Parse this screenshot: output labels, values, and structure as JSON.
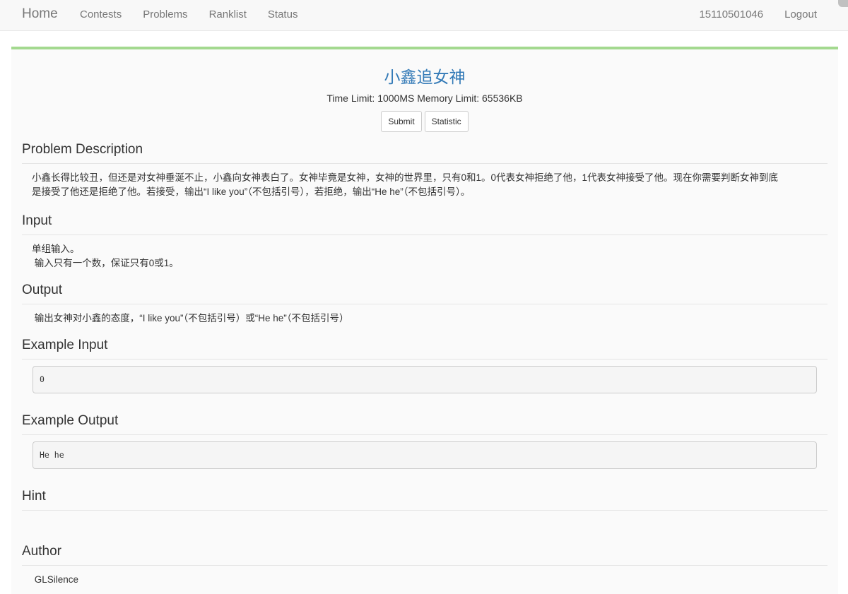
{
  "navbar": {
    "brand": "Home",
    "links": [
      "Contests",
      "Problems",
      "Ranklist",
      "Status"
    ],
    "user": "15110501046",
    "logout": "Logout"
  },
  "problem": {
    "title": "小鑫追女神",
    "limits": "Time Limit: 1000MS Memory Limit: 65536KB",
    "submit_label": "Submit",
    "statistic_label": "Statistic"
  },
  "sections": {
    "description_title": "Problem Description",
    "description_line1": "小鑫长得比较丑，但还是对女神垂涎不止，小鑫向女神表白了。女神毕竟是女神，女神的世界里，只有0和1。0代表女神拒绝了他，1代表女神接受了他。现在你需要判断女神到底",
    "description_line2": "是接受了他还是拒绝了他。若接受，输出“I like you”（不包括引号），若拒绝，输出“He he”（不包括引号）。",
    "input_title": "Input",
    "input_line1": "单组输入。",
    "input_line2": " 输入只有一个数，保证只有0或1。",
    "output_title": "Output",
    "output_text": " 输出女神对小鑫的态度，“I like you”（不包括引号）或“He he”（不包括引号）",
    "example_input_title": "Example Input",
    "example_input": "0",
    "example_output_title": "Example Output",
    "example_output": "He he",
    "hint_title": "Hint",
    "author_title": "Author",
    "author": " GLSilence"
  }
}
